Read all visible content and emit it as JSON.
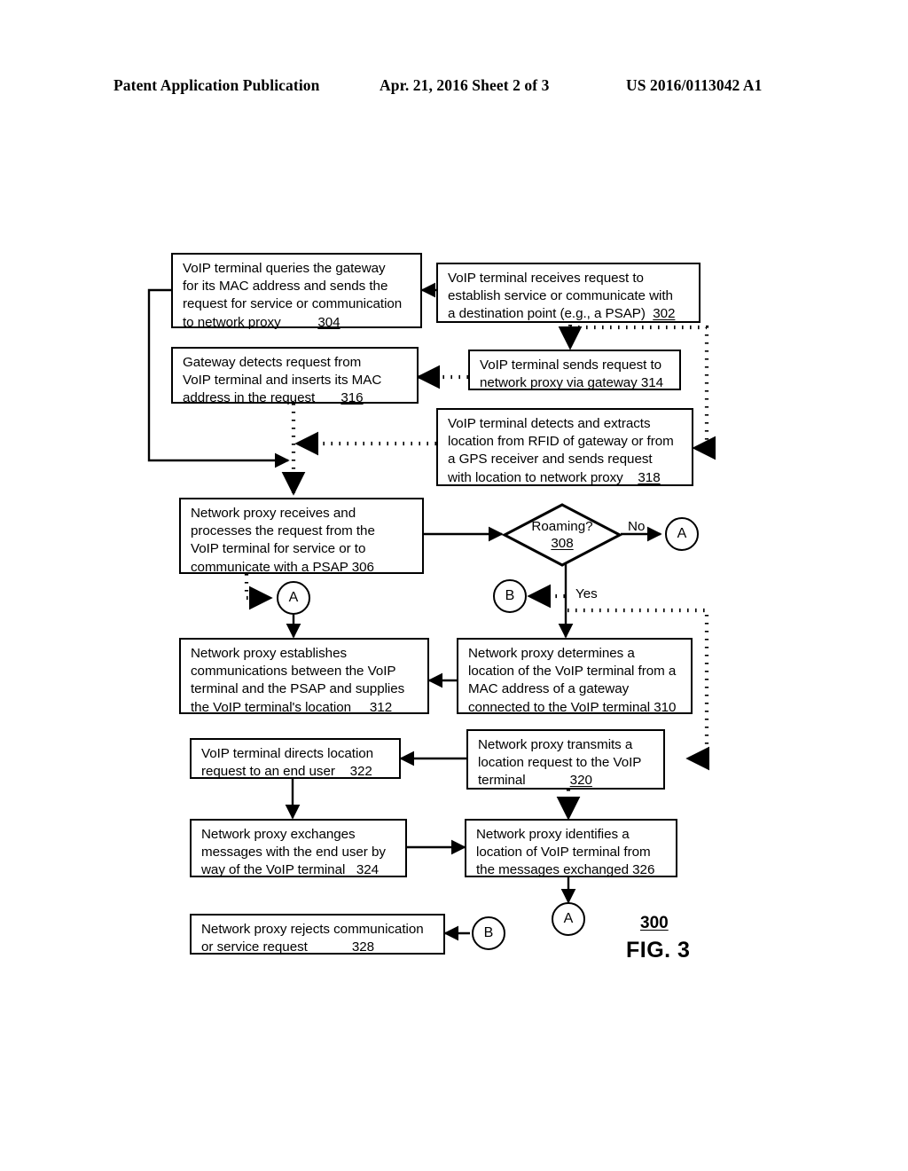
{
  "header": {
    "left": "Patent Application Publication",
    "middle": "Apr. 21, 2016  Sheet 2 of 3",
    "right": "US 2016/0113042 A1"
  },
  "figure": {
    "number": "300",
    "caption": "FIG. 3"
  },
  "boxes": {
    "b304": {
      "l1": "VoIP terminal queries the gateway",
      "l2": "for its MAC address and sends the",
      "l3": "request for service or communication",
      "l4": "to network proxy",
      "ref": "304"
    },
    "b302": {
      "l1": "VoIP terminal receives request to",
      "l2": "establish service or communicate with",
      "l3": "a destination point (e.g., a PSAP)",
      "ref": "302"
    },
    "b316": {
      "l1": "Gateway detects request from",
      "l2": "VoIP terminal and inserts its MAC",
      "l3": "address in the request",
      "ref": "316"
    },
    "b314": {
      "l1": "VoIP terminal sends request to",
      "l2": "network proxy via gateway",
      "ref": "314"
    },
    "b318": {
      "l1": "VoIP terminal detects and extracts",
      "l2": "location from RFID of gateway or from",
      "l3": "a GPS receiver and sends request",
      "l4": "with location to network proxy",
      "ref": "318"
    },
    "b306": {
      "l1": "Network proxy receives and",
      "l2": "processes the request from the",
      "l3": "VoIP terminal for service or to",
      "l4": "communicate with a PSAP",
      "ref": "306"
    },
    "b312": {
      "l1": "Network proxy establishes",
      "l2": "communications between the VoIP",
      "l3": "terminal and the PSAP and supplies",
      "l4": "the VoIP terminal's location",
      "ref": "312"
    },
    "b310": {
      "l1": "Network proxy determines a",
      "l2": "location of the VoIP terminal from a",
      "l3": "MAC address of a gateway",
      "l4": "connected to the VoIP terminal",
      "ref": "310"
    },
    "b322": {
      "l1": "VoIP terminal directs location",
      "l2": "request to an end user",
      "ref": "322"
    },
    "b320": {
      "l1": "Network proxy transmits a",
      "l2": "location request to the VoIP",
      "l3": "terminal",
      "ref": "320"
    },
    "b324": {
      "l1": "Network proxy exchanges",
      "l2": "messages with the end user by",
      "l3": "way of the VoIP terminal",
      "ref": "324"
    },
    "b326": {
      "l1": "Network proxy identifies a",
      "l2": "location of VoIP terminal from",
      "l3": "the messages exchanged",
      "ref": "326"
    },
    "b328": {
      "l1": "Network proxy rejects communication",
      "l2": "or service request",
      "ref": "328"
    }
  },
  "decision": {
    "question": "Roaming?",
    "ref": "308"
  },
  "edge_labels": {
    "no": "No",
    "yes": "Yes"
  },
  "connectors": {
    "a_top": "A",
    "a_left": "A",
    "a_bottom": "A",
    "b_right": "B",
    "b_bottom": "B"
  }
}
